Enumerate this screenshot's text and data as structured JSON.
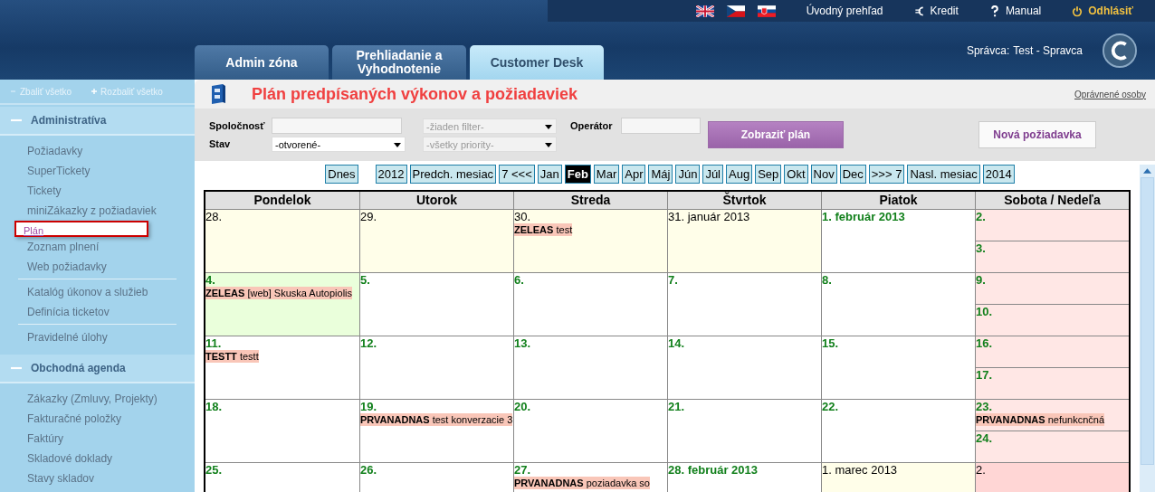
{
  "header": {
    "links": [
      {
        "kind": "home",
        "label": "Úvodný prehľad"
      },
      {
        "kind": "credit",
        "label": "Kredit"
      },
      {
        "kind": "help",
        "label": "Manual"
      },
      {
        "kind": "logout",
        "label": "Odhlásiť"
      }
    ],
    "tabs": [
      {
        "label": "Admin zóna",
        "selected": false
      },
      {
        "label": "Prehliadanie a Vyhodnotenie",
        "selected": false
      },
      {
        "label": "Customer Desk",
        "selected": true
      }
    ],
    "user_label": "Správca:",
    "user_name": "Test - Spravca"
  },
  "sidebar": {
    "collapse_all": "Zbaliť všetko",
    "expand_all": "Rozbaliť všetko",
    "sections": [
      {
        "title": "Administratíva",
        "expanded": true,
        "groups": [
          [
            {
              "label": "Požiadavky",
              "selected": false
            },
            {
              "label": "SuperTickety",
              "selected": false
            },
            {
              "label": "Tickety",
              "selected": false
            },
            {
              "label": "miniZákazky z požiadaviek",
              "selected": false
            },
            {
              "label": "Plán",
              "selected": true
            },
            {
              "label": "Zoznam plnení",
              "selected": false
            },
            {
              "label": "Web požiadavky",
              "selected": false
            }
          ],
          [
            {
              "label": "Katalóg úkonov a služieb",
              "selected": false
            },
            {
              "label": "Definícia ticketov",
              "selected": false
            }
          ],
          [
            {
              "label": "Pravidelné úlohy",
              "selected": false
            }
          ]
        ]
      },
      {
        "title": "Obchodná agenda",
        "expanded": true,
        "groups": [
          [
            {
              "label": "Zákazky (Zmluvy, Projekty)",
              "selected": false
            },
            {
              "label": "Fakturačné položky",
              "selected": false
            },
            {
              "label": "Faktúry",
              "selected": false
            },
            {
              "label": "Skladové doklady",
              "selected": false
            },
            {
              "label": "Stavy skladov",
              "selected": false
            }
          ]
        ]
      }
    ]
  },
  "page": {
    "title": "Plán predpísaných výkonov a požiadaviek",
    "authorized_link": "Oprávnené osoby"
  },
  "filters": {
    "company": {
      "label": "Spoločnosť"
    },
    "filter_select": {
      "placeholder": "-žiaden filter-"
    },
    "operator": {
      "label": "Operátor"
    },
    "status": {
      "label": "Stav",
      "value": "-otvorené-",
      "disabled": false
    },
    "priority_select": {
      "placeholder": "-všetky priority-"
    },
    "show_button": "Zobraziť plán",
    "new_button": "Nová požiadavka"
  },
  "nav": [
    {
      "label": "Dnes",
      "selected": false
    },
    {
      "label": "2012",
      "selected": false
    },
    {
      "label": "Predch. mesiac",
      "selected": false
    },
    {
      "label": "7 <<<",
      "selected": false
    },
    {
      "label": "Jan",
      "selected": false
    },
    {
      "label": "Feb",
      "selected": true
    },
    {
      "label": "Mar",
      "selected": false
    },
    {
      "label": "Apr",
      "selected": false
    },
    {
      "label": "Máj",
      "selected": false
    },
    {
      "label": "Jún",
      "selected": false
    },
    {
      "label": "Júl",
      "selected": false
    },
    {
      "label": "Aug",
      "selected": false
    },
    {
      "label": "Sep",
      "selected": false
    },
    {
      "label": "Okt",
      "selected": false
    },
    {
      "label": "Nov",
      "selected": false
    },
    {
      "label": "Dec",
      "selected": false
    },
    {
      "label": ">>> 7",
      "selected": false
    },
    {
      "label": "Nasl. mesiac",
      "selected": false
    },
    {
      "label": "2014",
      "selected": false
    }
  ],
  "calendar": {
    "columns": [
      "Pondelok",
      "Utorok",
      "Streda",
      "Štvrtok",
      "Piatok",
      "Sobota / Nedeľa"
    ],
    "weeks": [
      {
        "days": [
          {
            "day": "28.",
            "in_month": false,
            "today": false
          },
          {
            "day": "29.",
            "in_month": false,
            "today": false
          },
          {
            "day": "30.",
            "in_month": false,
            "today": false,
            "events": [
              {
                "code": "ZELEAS",
                "text": "test"
              }
            ]
          },
          {
            "day": "31. január 2013",
            "in_month": false,
            "today": false
          },
          {
            "day": "1. február 2013",
            "in_month": true,
            "today": false
          }
        ],
        "weekend": [
          {
            "day": "2.",
            "in_month": true
          },
          {
            "day": "3.",
            "in_month": true
          }
        ]
      },
      {
        "days": [
          {
            "day": "4.",
            "in_month": true,
            "today": true,
            "events": [
              {
                "code": "ZELEAS",
                "text": "[web] Skuska Autopiolis"
              }
            ]
          },
          {
            "day": "5.",
            "in_month": true,
            "today": false
          },
          {
            "day": "6.",
            "in_month": true,
            "today": false
          },
          {
            "day": "7.",
            "in_month": true,
            "today": false
          },
          {
            "day": "8.",
            "in_month": true,
            "today": false
          }
        ],
        "weekend": [
          {
            "day": "9.",
            "in_month": true
          },
          {
            "day": "10.",
            "in_month": true
          }
        ]
      },
      {
        "days": [
          {
            "day": "11.",
            "in_month": true,
            "today": false,
            "events": [
              {
                "code": "TESTT",
                "text": "testt"
              }
            ]
          },
          {
            "day": "12.",
            "in_month": true,
            "today": false
          },
          {
            "day": "13.",
            "in_month": true,
            "today": false
          },
          {
            "day": "14.",
            "in_month": true,
            "today": false
          },
          {
            "day": "15.",
            "in_month": true,
            "today": false
          }
        ],
        "weekend": [
          {
            "day": "16.",
            "in_month": true
          },
          {
            "day": "17.",
            "in_month": true
          }
        ]
      },
      {
        "days": [
          {
            "day": "18.",
            "in_month": true,
            "today": false
          },
          {
            "day": "19.",
            "in_month": true,
            "today": false,
            "events": [
              {
                "code": "PRVANADNAS",
                "text": "test konverzacie 3"
              }
            ]
          },
          {
            "day": "20.",
            "in_month": true,
            "today": false
          },
          {
            "day": "21.",
            "in_month": true,
            "today": false
          },
          {
            "day": "22.",
            "in_month": true,
            "today": false
          }
        ],
        "weekend": [
          {
            "day": "23.",
            "in_month": true,
            "events": [
              {
                "code": "PRVANADNAS",
                "text": "nefunkcnčná"
              }
            ]
          },
          {
            "day": "24.",
            "in_month": true
          }
        ]
      },
      {
        "days": [
          {
            "day": "25.",
            "in_month": true,
            "today": false
          },
          {
            "day": "26.",
            "in_month": true,
            "today": false
          },
          {
            "day": "27.",
            "in_month": true,
            "today": false,
            "events": [
              {
                "code": "PRVANADNAS",
                "text": "poziadavka so"
              }
            ]
          },
          {
            "day": "28. február 2013",
            "in_month": true,
            "today": false
          },
          {
            "day": "1. marec 2013",
            "in_month": false,
            "today": false
          }
        ],
        "weekend": [
          {
            "day": "2.",
            "in_month": false
          }
        ]
      }
    ]
  }
}
